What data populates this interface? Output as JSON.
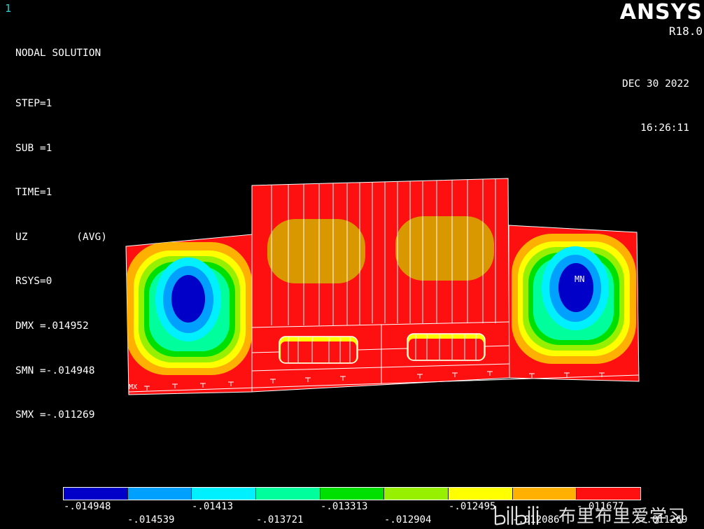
{
  "window_number": "1",
  "plot_info": {
    "title": "NODAL SOLUTION",
    "step": "STEP=1",
    "sub": "SUB =1",
    "time": "TIME=1",
    "component": "UZ        (AVG)",
    "rsys": "RSYS=0",
    "dmx": "DMX =.014952",
    "smn": "SMN =-.014948",
    "smx": "SMX =-.011269"
  },
  "brand": {
    "name": "ANSYS",
    "version": "R18.0"
  },
  "timestamp": {
    "date": "DEC 30 2022",
    "time": "16:26:11"
  },
  "markers": {
    "min": "MN",
    "max": "MX"
  },
  "legend": {
    "colors": [
      "#0000c8",
      "#00a0ff",
      "#00f0ff",
      "#00ff9c",
      "#00e000",
      "#96f000",
      "#ffff00",
      "#ffb000",
      "#ff1010"
    ],
    "upper_labels": [
      "-.014948",
      "-.01413",
      "-.013313",
      "-.012495",
      "-.011677"
    ],
    "lower_labels": [
      "-.014539",
      "-.013721",
      "-.012904",
      "-.012086",
      "-.011269"
    ]
  },
  "watermark": {
    "logo": "bilibili",
    "text": "布里布里爱学习"
  }
}
